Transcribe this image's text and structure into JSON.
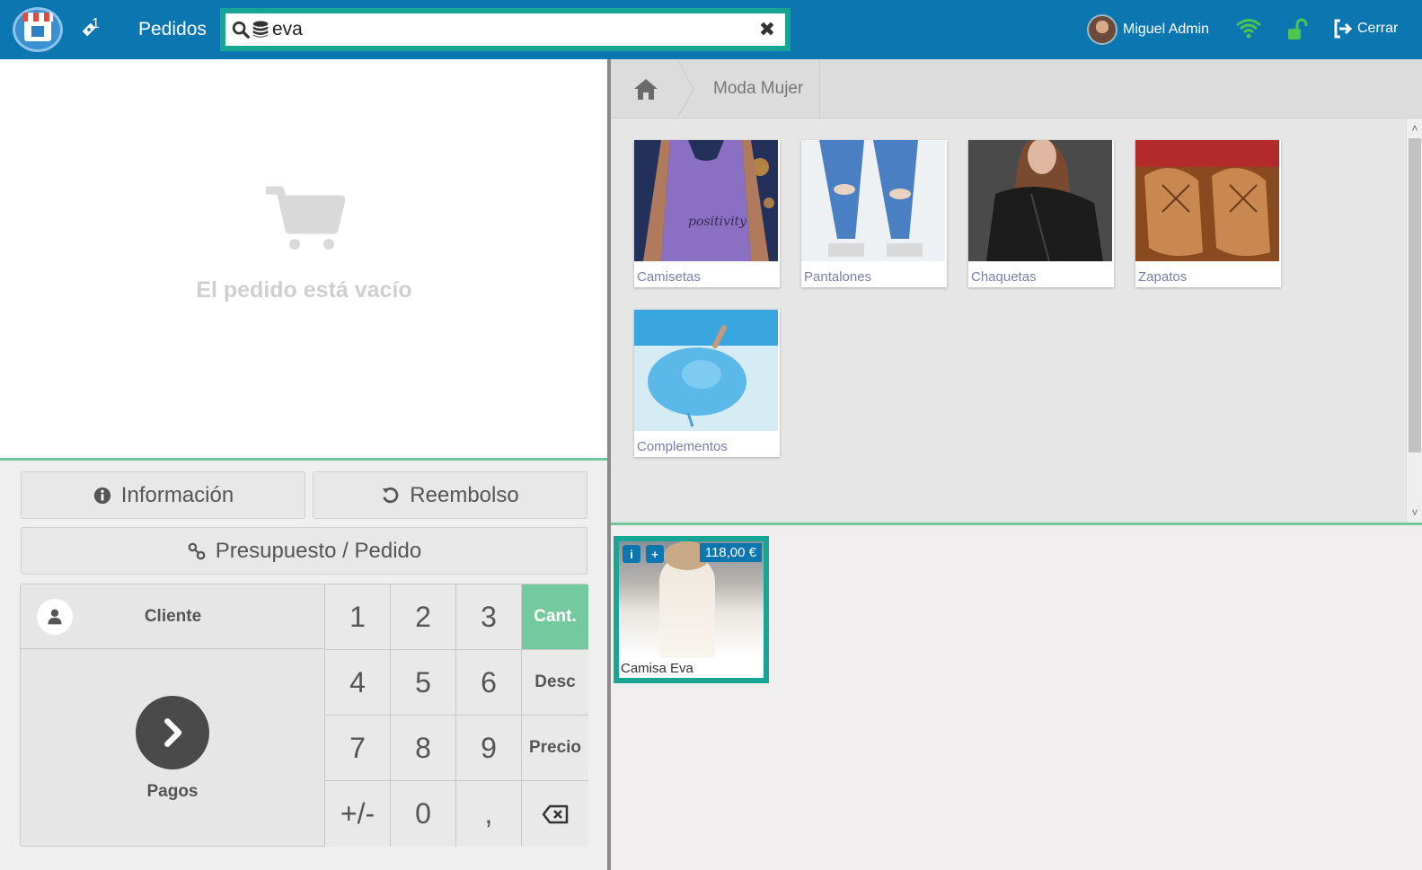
{
  "topbar": {
    "orders_label": "Pedidos",
    "orders_badge": "1",
    "search_value": "eva",
    "user_name": "Miguel Admin",
    "logout_label": "Cerrar",
    "colors": {
      "bar": "#0b76b0",
      "search_border": "#16a495",
      "wifi": "#4cc552",
      "lock": "#4cc552"
    }
  },
  "cart": {
    "empty_message": "El pedido está vacío"
  },
  "actions": {
    "info_label": "Información",
    "refund_label": "Reembolso",
    "quote_label": "Presupuesto / Pedido"
  },
  "keypad": {
    "customer_label": "Cliente",
    "payments_label": "Pagos",
    "keys": [
      "1",
      "2",
      "3",
      "4",
      "5",
      "6",
      "7",
      "8",
      "9",
      "+/-",
      "0",
      ","
    ],
    "modes": [
      "Cant.",
      "Desc",
      "Precio"
    ],
    "active_mode": "Cant."
  },
  "breadcrumb": {
    "items": [
      "Moda Mujer"
    ]
  },
  "categories": [
    {
      "label": "Camisetas"
    },
    {
      "label": "Pantalones"
    },
    {
      "label": "Chaquetas"
    },
    {
      "label": "Zapatos"
    },
    {
      "label": "Complementos"
    }
  ],
  "products": [
    {
      "name": "Camisa Eva",
      "price": "118,00 €"
    }
  ]
}
